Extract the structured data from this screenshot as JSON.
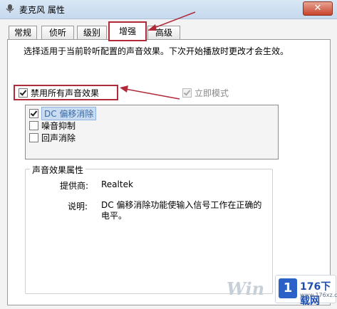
{
  "window": {
    "title": "麦克风 属性",
    "close_label": "✕"
  },
  "tabs": [
    {
      "label": "常规"
    },
    {
      "label": "侦听"
    },
    {
      "label": "级别"
    },
    {
      "label": "增强",
      "active": true
    },
    {
      "label": "高级"
    }
  ],
  "enhance": {
    "description": "选择适用于当前聆听配置的声音效果。下次开始播放时更改才会生效。",
    "disable_all": {
      "label": "禁用所有声音效果",
      "checked": true
    },
    "immediate_mode": {
      "label": "立即模式",
      "checked": true,
      "disabled": true
    },
    "effects": [
      {
        "label": "DC 偏移消除",
        "checked": true,
        "selected": true
      },
      {
        "label": "噪音抑制",
        "checked": false
      },
      {
        "label": "回声消除",
        "checked": false
      }
    ],
    "properties": {
      "title": "声音效果属性",
      "provider_label": "提供商:",
      "provider_value": "Realtek",
      "description_label": "说明:",
      "description_value": "DC 偏移消除功能使输入信号工作在正确的电平。"
    }
  },
  "watermark": {
    "text": "Win",
    "logo_badge": "1",
    "logo_name": "176下载网",
    "logo_url": "www.176xz.com"
  },
  "colors": {
    "highlight": "#b02a3a",
    "arrow": "#b02a3a"
  }
}
